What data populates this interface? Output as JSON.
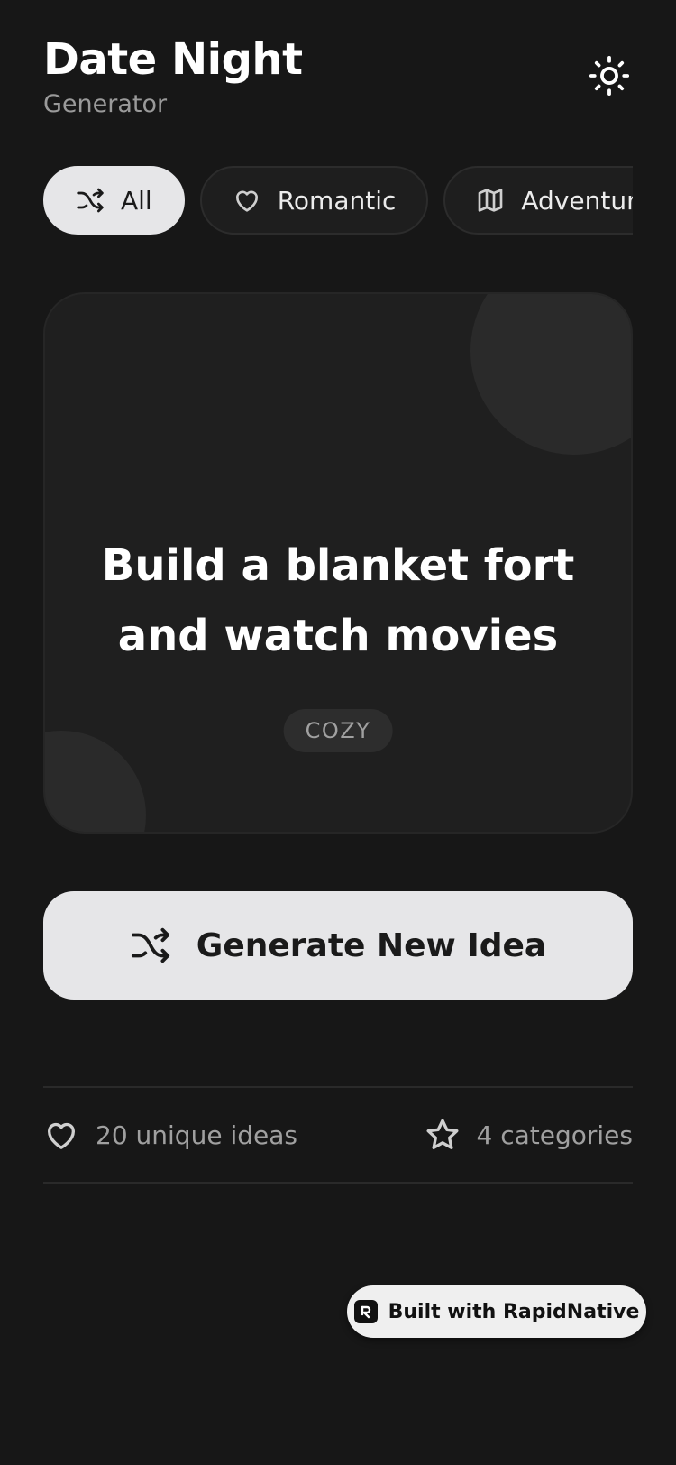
{
  "header": {
    "title": "Date Night",
    "subtitle": "Generator",
    "theme_icon": "sun-icon"
  },
  "categories": [
    {
      "label": "All",
      "icon": "shuffle-icon",
      "active": true
    },
    {
      "label": "Romantic",
      "icon": "heart-icon",
      "active": false
    },
    {
      "label": "Adventurous",
      "icon": "map-icon",
      "active": false
    }
  ],
  "idea_card": {
    "text": "Build a blanket fort and watch movies",
    "tag": "COZY"
  },
  "generate_button": {
    "label": "Generate New Idea",
    "icon": "shuffle-icon"
  },
  "stats": {
    "ideas_label": "20 unique ideas",
    "ideas_icon": "heart-icon",
    "categories_label": "4 categories",
    "categories_icon": "star-icon"
  },
  "badge": {
    "label": "Built with RapidNative",
    "icon": "rapidnative-logo-icon"
  },
  "colors": {
    "background": "#171717",
    "card": "#1f1f1f",
    "accent": "#e6e6e8",
    "muted_text": "#9a9a9a"
  }
}
